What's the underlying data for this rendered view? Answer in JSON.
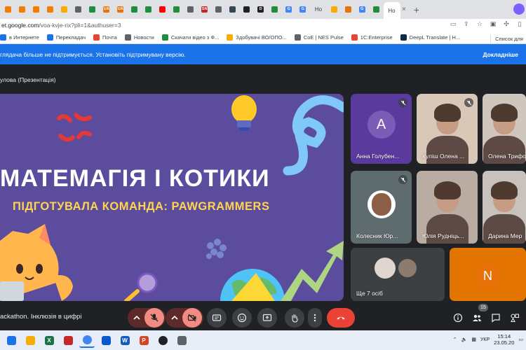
{
  "browser": {
    "tabs": [
      {
        "icon": "meet-icon",
        "color": "#f57c00"
      },
      {
        "icon": "meet-icon",
        "color": "#f57c00"
      },
      {
        "icon": "meet-icon",
        "color": "#f57c00"
      },
      {
        "icon": "meet-icon",
        "color": "#f57c00"
      },
      {
        "icon": "folder-icon",
        "color": "#f9ab00"
      },
      {
        "icon": "chrome-icon",
        "color": "#5f6368"
      },
      {
        "icon": "drive-icon",
        "color": "#1e8e3e"
      },
      {
        "icon": "ua-icon",
        "color": "#e8710a",
        "text": "UA"
      },
      {
        "icon": "ua-icon",
        "color": "#e8710a",
        "text": "UA"
      },
      {
        "icon": "drive-icon",
        "color": "#1e8e3e"
      },
      {
        "icon": "plus-green-icon",
        "color": "#1e8e3e"
      },
      {
        "icon": "youtube-icon",
        "color": "#ff0000"
      },
      {
        "icon": "plus-green-icon",
        "color": "#1e8e3e"
      },
      {
        "icon": "chrome-icon",
        "color": "#5f6368"
      },
      {
        "icon": "sn-icon",
        "color": "#c62828",
        "text": "SN"
      },
      {
        "icon": "chrome-icon",
        "color": "#5f6368"
      },
      {
        "icon": "hex-icon",
        "color": "#37474f"
      },
      {
        "icon": "terminal-icon",
        "color": "#202124"
      },
      {
        "icon": "d-icon",
        "color": "#202124",
        "text": "D"
      },
      {
        "icon": "drive-icon",
        "color": "#1e8e3e"
      },
      {
        "icon": "google-icon",
        "color": "#4285f4",
        "text": "G"
      },
      {
        "icon": "google-icon",
        "color": "#4285f4",
        "text": "G"
      }
    ],
    "active_tab_label": "Ho",
    "tabs_after": [
      {
        "icon": "bookmark-icon",
        "color": "#f9ab00"
      },
      {
        "icon": "heart-icon",
        "color": "#e8710a"
      },
      {
        "icon": "google-icon",
        "color": "#4285f4",
        "text": "G"
      },
      {
        "icon": "plus-green-icon",
        "color": "#1e8e3e"
      }
    ],
    "second_tab_label": "Ho",
    "url_host": "et.google.com",
    "url_path": "/voa-kvje-rix?pli=1&authuser=3",
    "bookmarks": [
      {
        "label": "в Интернете",
        "color": "#1a73e8"
      },
      {
        "label": "Перекладач",
        "color": "#1a73e8"
      },
      {
        "label": "Почта",
        "color": "#ea4335"
      },
      {
        "label": "Новости",
        "color": "#5f6368"
      },
      {
        "label": "Скачати відео з Ф...",
        "color": "#1e8e3e"
      },
      {
        "label": "Здобувачі ВО/ОПО...",
        "color": "#f9ab00"
      },
      {
        "label": "CoE | NES Pulse",
        "color": "#5f6368"
      },
      {
        "label": "1C:Enterprise",
        "color": "#ea4335"
      },
      {
        "label": "DeepL Translate | Н...",
        "color": "#0f2b46"
      }
    ],
    "bookmarks_other": "Список для"
  },
  "banner": {
    "message": "глядача більше не підтримується. Установіть підтримувану версію.",
    "more": "Докладніше"
  },
  "meet": {
    "presenter_label": "улова (Презентація)",
    "slide": {
      "title": "МАТЕМАГІЯ І КОТИКИ",
      "subtitle": "ПІДГОТУВАЛА КОМАНДА: PAWGRAMMERS"
    },
    "participants": [
      {
        "name": "Анна Голубен...",
        "avatar_letter": "A",
        "avatar_color": "#7b5cb6",
        "tile_color": "#5b3a9e",
        "muted": true
      },
      {
        "name": "Куліш Олена ...",
        "tile_color": "#d9c7b8",
        "muted": true
      },
      {
        "name": "Олена Трифо",
        "tile_color": "#cfc6bd",
        "muted": false
      },
      {
        "name": "Колесник Юр...",
        "tile_color": "#5f6c6f",
        "muted": true
      },
      {
        "name": "Юлія Рудніць...",
        "tile_color": "#b9ada3",
        "muted": false
      },
      {
        "name": "Дарина Мер",
        "tile_color": "#c7c2bd",
        "muted": false
      },
      {
        "name": "Ще 7 осіб",
        "tile_color": "#3c4043",
        "muted": false
      },
      {
        "name": "",
        "avatar_letter": "N",
        "avatar_color": "#e8710a",
        "tile_color": "#e37400",
        "muted": false
      }
    ],
    "meeting_title": "ackathon. Інклюзія в цифрі",
    "participants_count": "15"
  },
  "taskbar": {
    "items": [
      {
        "icon": "windows-icon",
        "color": "#1a73e8"
      },
      {
        "icon": "files-icon",
        "color": "#f9ab00"
      },
      {
        "icon": "excel-icon",
        "color": "#1e7145",
        "text": "X"
      },
      {
        "icon": "app-icon",
        "color": "#c62828"
      },
      {
        "icon": "chrome-icon",
        "color": "#4285f4"
      },
      {
        "icon": "app-icon",
        "color": "#0b57d0"
      },
      {
        "icon": "word-icon",
        "color": "#185abd",
        "text": "W"
      },
      {
        "icon": "powerpoint-icon",
        "color": "#d24726",
        "text": "P"
      },
      {
        "icon": "gear-icon",
        "color": "#202124"
      },
      {
        "icon": "app-icon",
        "color": "#5f6368"
      }
    ],
    "language": "УКР",
    "time": "15:14",
    "date": "23.05.20"
  },
  "colors": {
    "banner": "#1a73e8",
    "meet_bg": "#202124",
    "slide_bg": "#5b4c9e",
    "end_call": "#ea4335",
    "muted_btn": "#f28b82"
  }
}
